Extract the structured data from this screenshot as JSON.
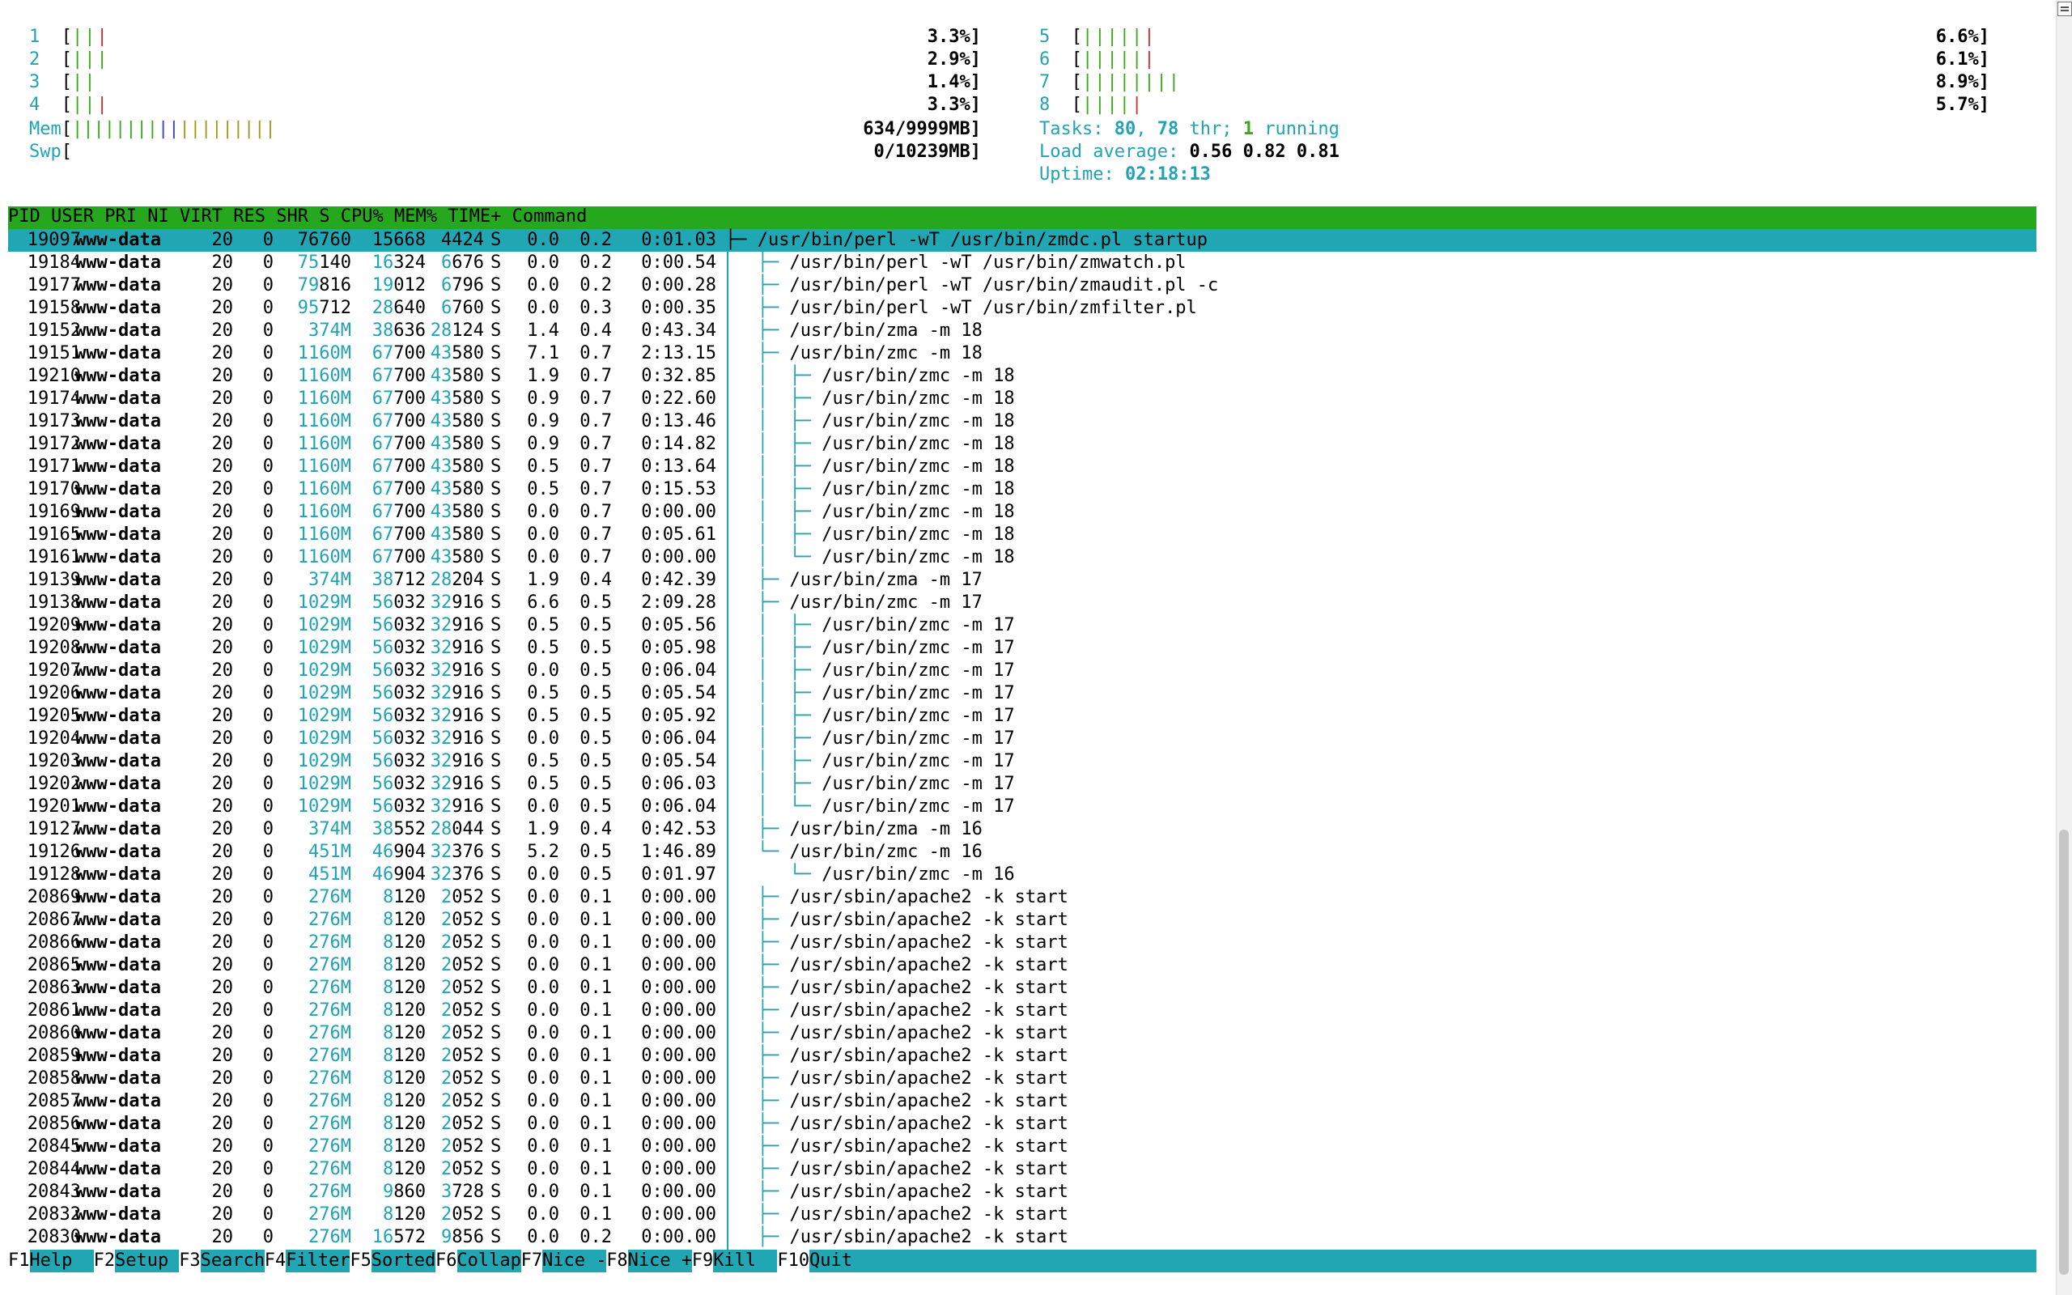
{
  "cpus_left": [
    {
      "label": "1",
      "g": "||",
      "r": "|",
      "pct": "3.3%]"
    },
    {
      "label": "2",
      "g": "|||",
      "r": "",
      "pct": "2.9%]"
    },
    {
      "label": "3",
      "g": "||",
      "r": "",
      "pct": "1.4%]"
    },
    {
      "label": "4",
      "g": "||",
      "r": "|",
      "pct": "3.3%]"
    }
  ],
  "cpus_right": [
    {
      "label": "5",
      "g": "|||||",
      "r": "|",
      "pct": "6.6%]"
    },
    {
      "label": "6",
      "g": "|||||",
      "r": "|",
      "pct": "6.1%]"
    },
    {
      "label": "7",
      "g": "||||||||",
      "r": "",
      "pct": "8.9%]"
    },
    {
      "label": "8",
      "g": "||||",
      "r": "|",
      "pct": "5.7%]"
    }
  ],
  "bracket": "[",
  "mem": {
    "label": "Mem",
    "g": "||||||||",
    "b": "||",
    "o": "|||||||||",
    "value": "634/9999MB]"
  },
  "swp": {
    "label": "Swp",
    "value": "0/10239MB]"
  },
  "tasks": {
    "prefix": "Tasks: ",
    "tasks": "80",
    "sep1": ", ",
    "thr": "78",
    "thr_label": " thr; ",
    "running": "1",
    "running_label": " running"
  },
  "load": {
    "prefix": "Load average: ",
    "l1": "0.56",
    "l2": "0.82",
    "l3": "0.81"
  },
  "uptime": {
    "prefix": "Uptime: ",
    "value": "02:18:13"
  },
  "columns": {
    "pid": "PID",
    "user": "USER",
    "pri": "PRI",
    "ni": "NI",
    "virt": "VIRT",
    "res": "RES",
    "shr": "SHR",
    "s": "S",
    "cpu": "CPU%",
    "mem": "MEM%",
    "time": "TIME+",
    "cmd": "Command"
  },
  "processes": [
    {
      "pid": "19097",
      "user": "www-data",
      "pri": "20",
      "ni": "0",
      "virt": "76760",
      "res": "15668",
      "shr": "4424",
      "s": "S",
      "cpu": "0.0",
      "mem": "0.2",
      "time": "0:01.03",
      "tree": "├─ ",
      "cmd": "/usr/bin/perl -wT /usr/bin/zmdc.pl startup"
    },
    {
      "pid": "19184",
      "user": "www-data",
      "pri": "20",
      "ni": "0",
      "virt": "75140",
      "res": "16324",
      "shr": "6676",
      "s": "S",
      "cpu": "0.0",
      "mem": "0.2",
      "time": "0:00.54",
      "tree": "   ├─ ",
      "cmd": "/usr/bin/perl -wT /usr/bin/zmwatch.pl"
    },
    {
      "pid": "19177",
      "user": "www-data",
      "pri": "20",
      "ni": "0",
      "virt": "79816",
      "res": "19012",
      "shr": "6796",
      "s": "S",
      "cpu": "0.0",
      "mem": "0.2",
      "time": "0:00.28",
      "tree": "   ├─ ",
      "cmd": "/usr/bin/perl -wT /usr/bin/zmaudit.pl -c"
    },
    {
      "pid": "19158",
      "user": "www-data",
      "pri": "20",
      "ni": "0",
      "virt": "95712",
      "res": "28640",
      "shr": "6760",
      "s": "S",
      "cpu": "0.0",
      "mem": "0.3",
      "time": "0:00.35",
      "tree": "   ├─ ",
      "cmd": "/usr/bin/perl -wT /usr/bin/zmfilter.pl"
    },
    {
      "pid": "19152",
      "user": "www-data",
      "pri": "20",
      "ni": "0",
      "virt": "374M",
      "res": "38636",
      "shr": "28124",
      "s": "S",
      "cpu": "1.4",
      "mem": "0.4",
      "time": "0:43.34",
      "tree": "   ├─ ",
      "cmd": "/usr/bin/zma -m 18"
    },
    {
      "pid": "19151",
      "user": "www-data",
      "pri": "20",
      "ni": "0",
      "virt": "1160M",
      "res": "67700",
      "shr": "43580",
      "s": "S",
      "cpu": "7.1",
      "mem": "0.7",
      "time": "2:13.15",
      "tree": "   ├─ ",
      "cmd": "/usr/bin/zmc -m 18"
    },
    {
      "pid": "19210",
      "user": "www-data",
      "pri": "20",
      "ni": "0",
      "virt": "1160M",
      "res": "67700",
      "shr": "43580",
      "s": "S",
      "cpu": "1.9",
      "mem": "0.7",
      "time": "0:32.85",
      "tree": "   │  ├─ ",
      "cmd": "/usr/bin/zmc -m 18"
    },
    {
      "pid": "19174",
      "user": "www-data",
      "pri": "20",
      "ni": "0",
      "virt": "1160M",
      "res": "67700",
      "shr": "43580",
      "s": "S",
      "cpu": "0.9",
      "mem": "0.7",
      "time": "0:22.60",
      "tree": "   │  ├─ ",
      "cmd": "/usr/bin/zmc -m 18"
    },
    {
      "pid": "19173",
      "user": "www-data",
      "pri": "20",
      "ni": "0",
      "virt": "1160M",
      "res": "67700",
      "shr": "43580",
      "s": "S",
      "cpu": "0.9",
      "mem": "0.7",
      "time": "0:13.46",
      "tree": "   │  ├─ ",
      "cmd": "/usr/bin/zmc -m 18"
    },
    {
      "pid": "19172",
      "user": "www-data",
      "pri": "20",
      "ni": "0",
      "virt": "1160M",
      "res": "67700",
      "shr": "43580",
      "s": "S",
      "cpu": "0.9",
      "mem": "0.7",
      "time": "0:14.82",
      "tree": "   │  ├─ ",
      "cmd": "/usr/bin/zmc -m 18"
    },
    {
      "pid": "19171",
      "user": "www-data",
      "pri": "20",
      "ni": "0",
      "virt": "1160M",
      "res": "67700",
      "shr": "43580",
      "s": "S",
      "cpu": "0.5",
      "mem": "0.7",
      "time": "0:13.64",
      "tree": "   │  ├─ ",
      "cmd": "/usr/bin/zmc -m 18"
    },
    {
      "pid": "19170",
      "user": "www-data",
      "pri": "20",
      "ni": "0",
      "virt": "1160M",
      "res": "67700",
      "shr": "43580",
      "s": "S",
      "cpu": "0.5",
      "mem": "0.7",
      "time": "0:15.53",
      "tree": "   │  ├─ ",
      "cmd": "/usr/bin/zmc -m 18"
    },
    {
      "pid": "19169",
      "user": "www-data",
      "pri": "20",
      "ni": "0",
      "virt": "1160M",
      "res": "67700",
      "shr": "43580",
      "s": "S",
      "cpu": "0.0",
      "mem": "0.7",
      "time": "0:00.00",
      "tree": "   │  ├─ ",
      "cmd": "/usr/bin/zmc -m 18"
    },
    {
      "pid": "19165",
      "user": "www-data",
      "pri": "20",
      "ni": "0",
      "virt": "1160M",
      "res": "67700",
      "shr": "43580",
      "s": "S",
      "cpu": "0.0",
      "mem": "0.7",
      "time": "0:05.61",
      "tree": "   │  ├─ ",
      "cmd": "/usr/bin/zmc -m 18"
    },
    {
      "pid": "19161",
      "user": "www-data",
      "pri": "20",
      "ni": "0",
      "virt": "1160M",
      "res": "67700",
      "shr": "43580",
      "s": "S",
      "cpu": "0.0",
      "mem": "0.7",
      "time": "0:00.00",
      "tree": "   │  └─ ",
      "cmd": "/usr/bin/zmc -m 18"
    },
    {
      "pid": "19139",
      "user": "www-data",
      "pri": "20",
      "ni": "0",
      "virt": "374M",
      "res": "38712",
      "shr": "28204",
      "s": "S",
      "cpu": "1.9",
      "mem": "0.4",
      "time": "0:42.39",
      "tree": "   ├─ ",
      "cmd": "/usr/bin/zma -m 17"
    },
    {
      "pid": "19138",
      "user": "www-data",
      "pri": "20",
      "ni": "0",
      "virt": "1029M",
      "res": "56032",
      "shr": "32916",
      "s": "S",
      "cpu": "6.6",
      "mem": "0.5",
      "time": "2:09.28",
      "tree": "   ├─ ",
      "cmd": "/usr/bin/zmc -m 17"
    },
    {
      "pid": "19209",
      "user": "www-data",
      "pri": "20",
      "ni": "0",
      "virt": "1029M",
      "res": "56032",
      "shr": "32916",
      "s": "S",
      "cpu": "0.5",
      "mem": "0.5",
      "time": "0:05.56",
      "tree": "   │  ├─ ",
      "cmd": "/usr/bin/zmc -m 17"
    },
    {
      "pid": "19208",
      "user": "www-data",
      "pri": "20",
      "ni": "0",
      "virt": "1029M",
      "res": "56032",
      "shr": "32916",
      "s": "S",
      "cpu": "0.5",
      "mem": "0.5",
      "time": "0:05.98",
      "tree": "   │  ├─ ",
      "cmd": "/usr/bin/zmc -m 17"
    },
    {
      "pid": "19207",
      "user": "www-data",
      "pri": "20",
      "ni": "0",
      "virt": "1029M",
      "res": "56032",
      "shr": "32916",
      "s": "S",
      "cpu": "0.0",
      "mem": "0.5",
      "time": "0:06.04",
      "tree": "   │  ├─ ",
      "cmd": "/usr/bin/zmc -m 17"
    },
    {
      "pid": "19206",
      "user": "www-data",
      "pri": "20",
      "ni": "0",
      "virt": "1029M",
      "res": "56032",
      "shr": "32916",
      "s": "S",
      "cpu": "0.5",
      "mem": "0.5",
      "time": "0:05.54",
      "tree": "   │  ├─ ",
      "cmd": "/usr/bin/zmc -m 17"
    },
    {
      "pid": "19205",
      "user": "www-data",
      "pri": "20",
      "ni": "0",
      "virt": "1029M",
      "res": "56032",
      "shr": "32916",
      "s": "S",
      "cpu": "0.5",
      "mem": "0.5",
      "time": "0:05.92",
      "tree": "   │  ├─ ",
      "cmd": "/usr/bin/zmc -m 17"
    },
    {
      "pid": "19204",
      "user": "www-data",
      "pri": "20",
      "ni": "0",
      "virt": "1029M",
      "res": "56032",
      "shr": "32916",
      "s": "S",
      "cpu": "0.0",
      "mem": "0.5",
      "time": "0:06.04",
      "tree": "   │  ├─ ",
      "cmd": "/usr/bin/zmc -m 17"
    },
    {
      "pid": "19203",
      "user": "www-data",
      "pri": "20",
      "ni": "0",
      "virt": "1029M",
      "res": "56032",
      "shr": "32916",
      "s": "S",
      "cpu": "0.5",
      "mem": "0.5",
      "time": "0:05.54",
      "tree": "   │  ├─ ",
      "cmd": "/usr/bin/zmc -m 17"
    },
    {
      "pid": "19202",
      "user": "www-data",
      "pri": "20",
      "ni": "0",
      "virt": "1029M",
      "res": "56032",
      "shr": "32916",
      "s": "S",
      "cpu": "0.5",
      "mem": "0.5",
      "time": "0:06.03",
      "tree": "   │  ├─ ",
      "cmd": "/usr/bin/zmc -m 17"
    },
    {
      "pid": "19201",
      "user": "www-data",
      "pri": "20",
      "ni": "0",
      "virt": "1029M",
      "res": "56032",
      "shr": "32916",
      "s": "S",
      "cpu": "0.0",
      "mem": "0.5",
      "time": "0:06.04",
      "tree": "   │  └─ ",
      "cmd": "/usr/bin/zmc -m 17"
    },
    {
      "pid": "19127",
      "user": "www-data",
      "pri": "20",
      "ni": "0",
      "virt": "374M",
      "res": "38552",
      "shr": "28044",
      "s": "S",
      "cpu": "1.9",
      "mem": "0.4",
      "time": "0:42.53",
      "tree": "   ├─ ",
      "cmd": "/usr/bin/zma -m 16"
    },
    {
      "pid": "19126",
      "user": "www-data",
      "pri": "20",
      "ni": "0",
      "virt": "451M",
      "res": "46904",
      "shr": "32376",
      "s": "S",
      "cpu": "5.2",
      "mem": "0.5",
      "time": "1:46.89",
      "tree": "   └─ ",
      "cmd": "/usr/bin/zmc -m 16"
    },
    {
      "pid": "19128",
      "user": "www-data",
      "pri": "20",
      "ni": "0",
      "virt": "451M",
      "res": "46904",
      "shr": "32376",
      "s": "S",
      "cpu": "0.0",
      "mem": "0.5",
      "time": "0:01.97",
      "tree": "      └─ ",
      "cmd": "/usr/bin/zmc -m 16"
    },
    {
      "pid": "20869",
      "user": "www-data",
      "pri": "20",
      "ni": "0",
      "virt": "276M",
      "res": "8120",
      "shr": "2052",
      "s": "S",
      "cpu": "0.0",
      "mem": "0.1",
      "time": "0:00.00",
      "tree": "   ├─ ",
      "cmd": "/usr/sbin/apache2 -k start"
    },
    {
      "pid": "20867",
      "user": "www-data",
      "pri": "20",
      "ni": "0",
      "virt": "276M",
      "res": "8120",
      "shr": "2052",
      "s": "S",
      "cpu": "0.0",
      "mem": "0.1",
      "time": "0:00.00",
      "tree": "   ├─ ",
      "cmd": "/usr/sbin/apache2 -k start"
    },
    {
      "pid": "20866",
      "user": "www-data",
      "pri": "20",
      "ni": "0",
      "virt": "276M",
      "res": "8120",
      "shr": "2052",
      "s": "S",
      "cpu": "0.0",
      "mem": "0.1",
      "time": "0:00.00",
      "tree": "   ├─ ",
      "cmd": "/usr/sbin/apache2 -k start"
    },
    {
      "pid": "20865",
      "user": "www-data",
      "pri": "20",
      "ni": "0",
      "virt": "276M",
      "res": "8120",
      "shr": "2052",
      "s": "S",
      "cpu": "0.0",
      "mem": "0.1",
      "time": "0:00.00",
      "tree": "   ├─ ",
      "cmd": "/usr/sbin/apache2 -k start"
    },
    {
      "pid": "20863",
      "user": "www-data",
      "pri": "20",
      "ni": "0",
      "virt": "276M",
      "res": "8120",
      "shr": "2052",
      "s": "S",
      "cpu": "0.0",
      "mem": "0.1",
      "time": "0:00.00",
      "tree": "   ├─ ",
      "cmd": "/usr/sbin/apache2 -k start"
    },
    {
      "pid": "20861",
      "user": "www-data",
      "pri": "20",
      "ni": "0",
      "virt": "276M",
      "res": "8120",
      "shr": "2052",
      "s": "S",
      "cpu": "0.0",
      "mem": "0.1",
      "time": "0:00.00",
      "tree": "   ├─ ",
      "cmd": "/usr/sbin/apache2 -k start"
    },
    {
      "pid": "20860",
      "user": "www-data",
      "pri": "20",
      "ni": "0",
      "virt": "276M",
      "res": "8120",
      "shr": "2052",
      "s": "S",
      "cpu": "0.0",
      "mem": "0.1",
      "time": "0:00.00",
      "tree": "   ├─ ",
      "cmd": "/usr/sbin/apache2 -k start"
    },
    {
      "pid": "20859",
      "user": "www-data",
      "pri": "20",
      "ni": "0",
      "virt": "276M",
      "res": "8120",
      "shr": "2052",
      "s": "S",
      "cpu": "0.0",
      "mem": "0.1",
      "time": "0:00.00",
      "tree": "   ├─ ",
      "cmd": "/usr/sbin/apache2 -k start"
    },
    {
      "pid": "20858",
      "user": "www-data",
      "pri": "20",
      "ni": "0",
      "virt": "276M",
      "res": "8120",
      "shr": "2052",
      "s": "S",
      "cpu": "0.0",
      "mem": "0.1",
      "time": "0:00.00",
      "tree": "   ├─ ",
      "cmd": "/usr/sbin/apache2 -k start"
    },
    {
      "pid": "20857",
      "user": "www-data",
      "pri": "20",
      "ni": "0",
      "virt": "276M",
      "res": "8120",
      "shr": "2052",
      "s": "S",
      "cpu": "0.0",
      "mem": "0.1",
      "time": "0:00.00",
      "tree": "   ├─ ",
      "cmd": "/usr/sbin/apache2 -k start"
    },
    {
      "pid": "20856",
      "user": "www-data",
      "pri": "20",
      "ni": "0",
      "virt": "276M",
      "res": "8120",
      "shr": "2052",
      "s": "S",
      "cpu": "0.0",
      "mem": "0.1",
      "time": "0:00.00",
      "tree": "   ├─ ",
      "cmd": "/usr/sbin/apache2 -k start"
    },
    {
      "pid": "20845",
      "user": "www-data",
      "pri": "20",
      "ni": "0",
      "virt": "276M",
      "res": "8120",
      "shr": "2052",
      "s": "S",
      "cpu": "0.0",
      "mem": "0.1",
      "time": "0:00.00",
      "tree": "   ├─ ",
      "cmd": "/usr/sbin/apache2 -k start"
    },
    {
      "pid": "20844",
      "user": "www-data",
      "pri": "20",
      "ni": "0",
      "virt": "276M",
      "res": "8120",
      "shr": "2052",
      "s": "S",
      "cpu": "0.0",
      "mem": "0.1",
      "time": "0:00.00",
      "tree": "   ├─ ",
      "cmd": "/usr/sbin/apache2 -k start"
    },
    {
      "pid": "20843",
      "user": "www-data",
      "pri": "20",
      "ni": "0",
      "virt": "276M",
      "res": "9860",
      "shr": "3728",
      "s": "S",
      "cpu": "0.0",
      "mem": "0.1",
      "time": "0:00.00",
      "tree": "   ├─ ",
      "cmd": "/usr/sbin/apache2 -k start"
    },
    {
      "pid": "20832",
      "user": "www-data",
      "pri": "20",
      "ni": "0",
      "virt": "276M",
      "res": "8120",
      "shr": "2052",
      "s": "S",
      "cpu": "0.0",
      "mem": "0.1",
      "time": "0:00.00",
      "tree": "   ├─ ",
      "cmd": "/usr/sbin/apache2 -k start"
    },
    {
      "pid": "20830",
      "user": "www-data",
      "pri": "20",
      "ni": "0",
      "virt": "276M",
      "res": "16572",
      "shr": "9856",
      "s": "S",
      "cpu": "0.0",
      "mem": "0.2",
      "time": "0:00.00",
      "tree": "   ├─ ",
      "cmd": "/usr/sbin/apache2 -k start"
    }
  ],
  "fkeys": [
    {
      "key": "F1",
      "label": "Help  "
    },
    {
      "key": "F2",
      "label": "Setup "
    },
    {
      "key": "F3",
      "label": "Search"
    },
    {
      "key": "F4",
      "label": "Filter"
    },
    {
      "key": "F5",
      "label": "Sorted"
    },
    {
      "key": "F6",
      "label": "Collap"
    },
    {
      "key": "F7",
      "label": "Nice -"
    },
    {
      "key": "F8",
      "label": "Nice +"
    },
    {
      "key": "F9",
      "label": "Kill  "
    },
    {
      "key": "F10",
      "label": "Quit  "
    }
  ],
  "colors": {
    "header": "#26a81e",
    "selected": "#21a7b4",
    "cyan": "#1fa3b6",
    "green": "#3aaa1a",
    "red": "#d22d2d"
  }
}
